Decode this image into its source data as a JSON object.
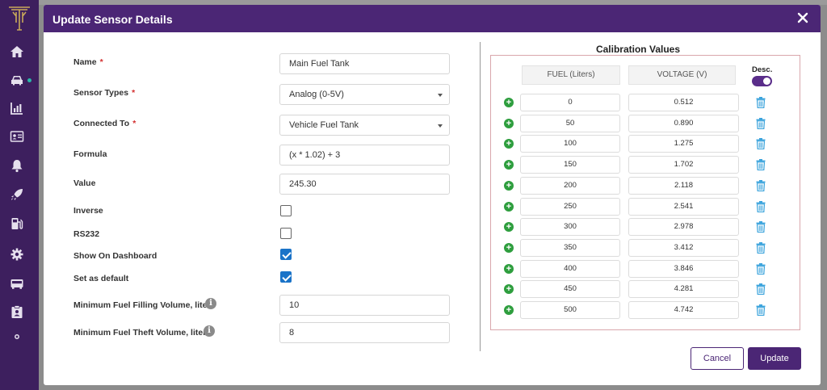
{
  "modal": {
    "title": "Update Sensor Details",
    "cancel_label": "Cancel",
    "update_label": "Update"
  },
  "form": {
    "name": {
      "label": "Name",
      "required_mark": "*",
      "value": "Main Fuel Tank"
    },
    "sensor_types": {
      "label": "Sensor Types",
      "required_mark": "*",
      "value": "Analog (0-5V)"
    },
    "connected_to": {
      "label": "Connected To",
      "required_mark": "*",
      "value": "Vehicle Fuel Tank"
    },
    "formula": {
      "label": "Formula",
      "value": "(x * 1.02) + 3"
    },
    "value": {
      "label": "Value",
      "value": "245.30"
    },
    "inverse": {
      "label": "Inverse",
      "checked": false
    },
    "rs232": {
      "label": "RS232",
      "checked": false
    },
    "show_on_dashboard": {
      "label": "Show On Dashboard",
      "checked": true
    },
    "set_as_default": {
      "label": "Set as default",
      "checked": true
    },
    "min_fuel_filling": {
      "label": "Minimum Fuel Filling Volume, liters",
      "info_icon": "i",
      "value": "10"
    },
    "min_fuel_theft": {
      "label": "Minimum Fuel Theft Volume, liters",
      "info_icon": "i",
      "value": "8"
    }
  },
  "calibration": {
    "title": "Calibration Values",
    "fuel_header": "FUEL (Liters)",
    "voltage_header": "VOLTAGE (V)",
    "desc_label": "Desc.",
    "desc_enabled": true,
    "add_icon": "+",
    "rows": [
      {
        "fuel": "0",
        "voltage": "0.512"
      },
      {
        "fuel": "50",
        "voltage": "0.890"
      },
      {
        "fuel": "100",
        "voltage": "1.275"
      },
      {
        "fuel": "150",
        "voltage": "1.702"
      },
      {
        "fuel": "200",
        "voltage": "2.118"
      },
      {
        "fuel": "250",
        "voltage": "2.541"
      },
      {
        "fuel": "300",
        "voltage": "2.978"
      },
      {
        "fuel": "350",
        "voltage": "3.412"
      },
      {
        "fuel": "400",
        "voltage": "3.846"
      },
      {
        "fuel": "450",
        "voltage": "4.281"
      },
      {
        "fuel": "500",
        "voltage": "4.742"
      }
    ]
  },
  "colors": {
    "sidebar": "#3d1f5e",
    "header": "#4b2675",
    "accent": "#5a2d8a",
    "checkbox": "#1a73c8",
    "add": "#2e9e3e",
    "trash": "#3aa3dc",
    "required": "#d32f2f"
  },
  "sidebar": {
    "items": [
      "home-icon",
      "car-icon",
      "chart-icon",
      "id-card-icon",
      "bell-icon",
      "rocket-icon",
      "fuel-pump-icon",
      "gear-icon",
      "bus-icon",
      "clipboard-icon",
      "more-icon"
    ]
  }
}
